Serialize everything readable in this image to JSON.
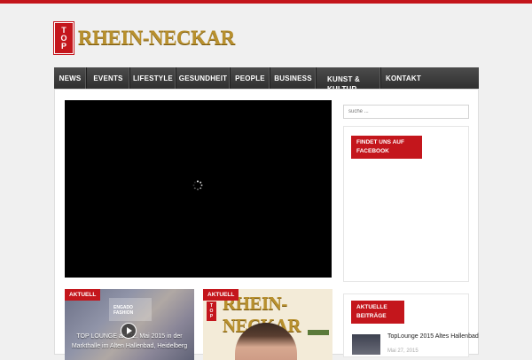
{
  "logo": {
    "badge_lines": [
      "T",
      "O",
      "P"
    ],
    "text": "RHEIN-NECKAR"
  },
  "nav": {
    "items": [
      {
        "label": "News"
      },
      {
        "label": "Events"
      },
      {
        "label": "Lifestyle"
      },
      {
        "label": "Gesundheit"
      },
      {
        "label": "People"
      },
      {
        "label": "Business"
      },
      {
        "label": "Kunst &",
        "label2": "Kultur"
      },
      {
        "label": "Kontakt"
      }
    ]
  },
  "search": {
    "placeholder": "suche ..."
  },
  "sidebar": {
    "facebook_title_line1": "Findet uns auf",
    "facebook_title_line2": "Facebook",
    "recent_title_line1": "Aktuelle",
    "recent_title_line2": "Beiträge",
    "recent_post": {
      "title": "TopLounge 2015 Altes Hallenbad",
      "date": "Mai 27, 2015"
    }
  },
  "cards": [
    {
      "tag": "Aktuell",
      "title": "TOP LOUNGE am 22. Mai 2015 in der Markthalle im Alten Hallenbad, Heidelberg",
      "overlay": "ENGADO FASHION"
    },
    {
      "tag": "Aktuell",
      "logo": "RHEIN-NECKAR"
    }
  ],
  "colors": {
    "accent": "#c4161c",
    "nav_bg": "#3a3a3a",
    "logo_gold": "#b8902e"
  }
}
